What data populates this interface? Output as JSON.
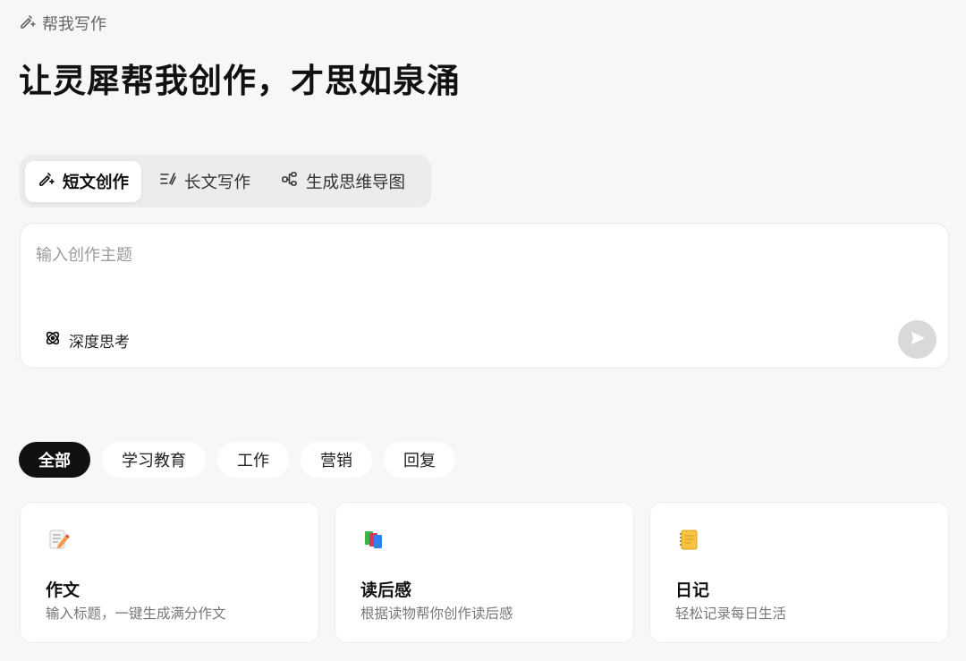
{
  "breadcrumb": {
    "label": "帮我写作",
    "icon": "pen-sparkle-icon"
  },
  "headline": "让灵犀帮我创作，才思如泉涌",
  "mode_tabs": [
    {
      "label": "短文创作",
      "icon": "pen-sparkle-icon",
      "active": true
    },
    {
      "label": "长文写作",
      "icon": "long-text-icon",
      "active": false
    },
    {
      "label": "生成思维导图",
      "icon": "mindmap-icon",
      "active": false
    }
  ],
  "composer": {
    "placeholder": "输入创作主题",
    "value": "",
    "deep_think_label": "深度思考",
    "deep_think_icon": "atom-icon",
    "send_icon": "send-icon"
  },
  "categories": [
    {
      "label": "全部",
      "active": true
    },
    {
      "label": "学习教育",
      "active": false
    },
    {
      "label": "工作",
      "active": false
    },
    {
      "label": "营销",
      "active": false
    },
    {
      "label": "回复",
      "active": false
    }
  ],
  "cards": [
    {
      "title": "作文",
      "desc": "输入标题，一键生成满分作文",
      "icon": "memo-pencil-icon"
    },
    {
      "title": "读后感",
      "desc": "根据读物帮你创作读后感",
      "icon": "books-icon"
    },
    {
      "title": "日记",
      "desc": "轻松记录每日生活",
      "icon": "notebook-icon"
    }
  ],
  "colors": {
    "background": "#f7f7f7",
    "active_chip": "#111111",
    "send_button": "#d9d9d9"
  }
}
